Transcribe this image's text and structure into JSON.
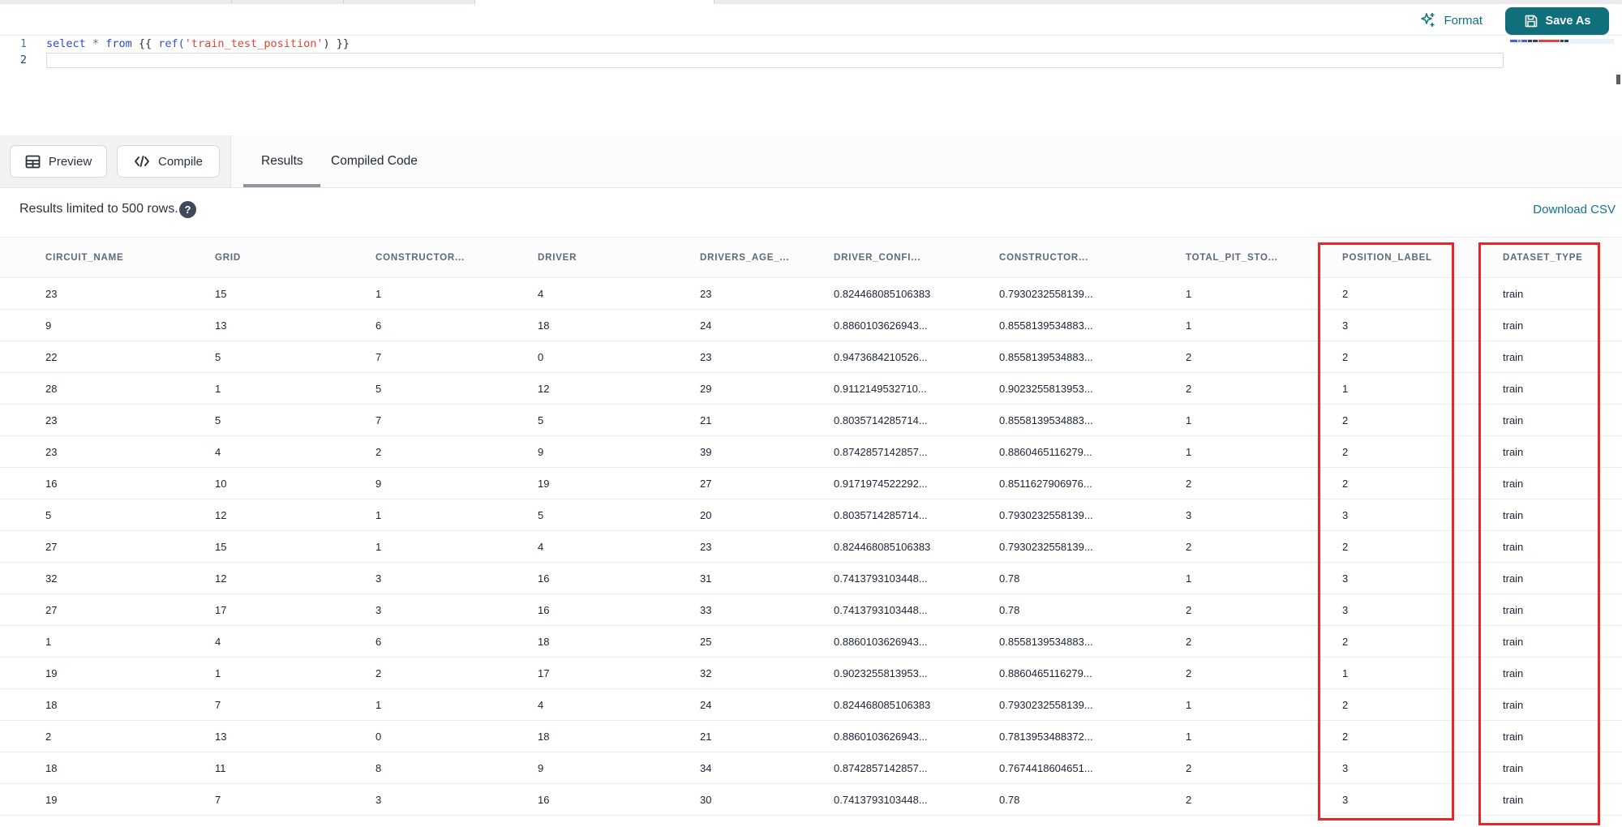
{
  "topbar": {
    "format_label": "Format",
    "save_as_label": "Save As"
  },
  "editor": {
    "gutter": {
      "line1": "1",
      "line2": "2"
    },
    "code": {
      "kw_select": "select",
      "op_star": "*",
      "kw_from": "from",
      "jinja_open": "{{",
      "fn_ref": "ref(",
      "str_model": "'train_test_position'",
      "paren_close": ")",
      "jinja_close": "}}"
    }
  },
  "toolbar": {
    "preview_label": "Preview",
    "compile_label": "Compile",
    "tabs": [
      {
        "label": "Results",
        "active": true
      },
      {
        "label": "Compiled Code",
        "active": false
      }
    ]
  },
  "results_bar": {
    "info_text": "Results limited to 500 rows.",
    "help_icon": "question-mark-circle",
    "download_label": "Download CSV"
  },
  "colors": {
    "accent_teal": "#0e7480",
    "save_button_bg": "#0f6f7a",
    "annotation_red": "#ee2424",
    "code_keyword_blue": "#2b46d4",
    "code_string_red": "#e0453c"
  },
  "table": {
    "columns": [
      "CIRCUIT_NAME",
      "GRID",
      "CONSTRUCTOR...",
      "DRIVER",
      "DRIVERS_AGE_...",
      "DRIVER_CONFI...",
      "CONSTRUCTOR...",
      "TOTAL_PIT_STO...",
      "POSITION_LABEL",
      "DATASET_TYPE"
    ],
    "rows": [
      [
        "23",
        "15",
        "1",
        "4",
        "23",
        "0.824468085106383",
        "0.7930232558139...",
        "1",
        "2",
        "train"
      ],
      [
        "9",
        "13",
        "6",
        "18",
        "24",
        "0.8860103626943...",
        "0.8558139534883...",
        "1",
        "3",
        "train"
      ],
      [
        "22",
        "5",
        "7",
        "0",
        "23",
        "0.9473684210526...",
        "0.8558139534883...",
        "2",
        "2",
        "train"
      ],
      [
        "28",
        "1",
        "5",
        "12",
        "29",
        "0.9112149532710...",
        "0.9023255813953...",
        "2",
        "1",
        "train"
      ],
      [
        "23",
        "5",
        "7",
        "5",
        "21",
        "0.8035714285714...",
        "0.8558139534883...",
        "1",
        "2",
        "train"
      ],
      [
        "23",
        "4",
        "2",
        "9",
        "39",
        "0.8742857142857...",
        "0.8860465116279...",
        "1",
        "2",
        "train"
      ],
      [
        "16",
        "10",
        "9",
        "19",
        "27",
        "0.9171974522292...",
        "0.8511627906976...",
        "2",
        "2",
        "train"
      ],
      [
        "5",
        "12",
        "1",
        "5",
        "20",
        "0.8035714285714...",
        "0.7930232558139...",
        "3",
        "3",
        "train"
      ],
      [
        "27",
        "15",
        "1",
        "4",
        "23",
        "0.824468085106383",
        "0.7930232558139...",
        "2",
        "2",
        "train"
      ],
      [
        "32",
        "12",
        "3",
        "16",
        "31",
        "0.7413793103448...",
        "0.78",
        "1",
        "3",
        "train"
      ],
      [
        "27",
        "17",
        "3",
        "16",
        "33",
        "0.7413793103448...",
        "0.78",
        "2",
        "3",
        "train"
      ],
      [
        "1",
        "4",
        "6",
        "18",
        "25",
        "0.8860103626943...",
        "0.8558139534883...",
        "2",
        "2",
        "train"
      ],
      [
        "19",
        "1",
        "2",
        "17",
        "32",
        "0.9023255813953...",
        "0.8860465116279...",
        "2",
        "1",
        "train"
      ],
      [
        "18",
        "7",
        "1",
        "4",
        "24",
        "0.824468085106383",
        "0.7930232558139...",
        "1",
        "2",
        "train"
      ],
      [
        "2",
        "13",
        "0",
        "18",
        "21",
        "0.8860103626943...",
        "0.7813953488372...",
        "1",
        "2",
        "train"
      ],
      [
        "18",
        "11",
        "8",
        "9",
        "34",
        "0.8742857142857...",
        "0.7674418604651...",
        "2",
        "3",
        "train"
      ],
      [
        "19",
        "7",
        "3",
        "16",
        "30",
        "0.7413793103448...",
        "0.78",
        "2",
        "3",
        "train"
      ]
    ],
    "annotated_columns": [
      "POSITION_LABEL",
      "DATASET_TYPE"
    ]
  }
}
